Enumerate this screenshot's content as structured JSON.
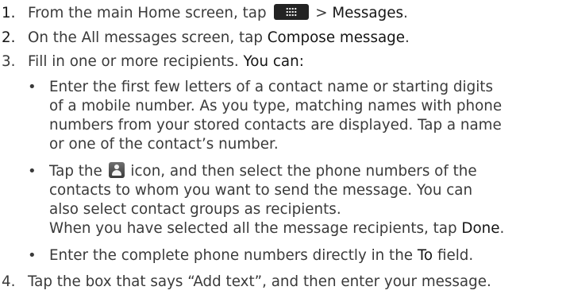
{
  "steps": [
    {
      "number": "1.",
      "pre": "From the main Home screen, tap",
      "icon": "apps-grid-icon",
      "sep": ">",
      "bold": "Messages",
      "post": "."
    },
    {
      "number": "2.",
      "pre": "On the All messages screen, tap",
      "bold": "Compose message",
      "post": "."
    },
    {
      "number": "3.",
      "pre": "Fill in one or more recipients.",
      "bold": "You can:",
      "bullets": [
        {
          "lines": [
            "Enter the first few letters of a contact name or starting digits",
            "of a mobile number. As you type, matching names with phone",
            "numbers from your stored contacts are displayed. Tap a name",
            "or one of the contact’s number."
          ]
        },
        {
          "first_pre": "Tap the",
          "icon": "contact-person-icon",
          "first_post": "icon, and then select the phone numbers of the",
          "lines": [
            "contacts to whom you want to send the message. You can",
            "also select contact groups as recipients."
          ],
          "done_pre": "When you have selected all the message recipients, tap",
          "done_bold": "Done",
          "done_post": "."
        },
        {
          "pre": "Enter the complete phone numbers directly in the",
          "bold": "To",
          "post": "field."
        }
      ]
    },
    {
      "number": "4.",
      "text": "Tap the box that says “Add text”, and then enter your message."
    }
  ]
}
